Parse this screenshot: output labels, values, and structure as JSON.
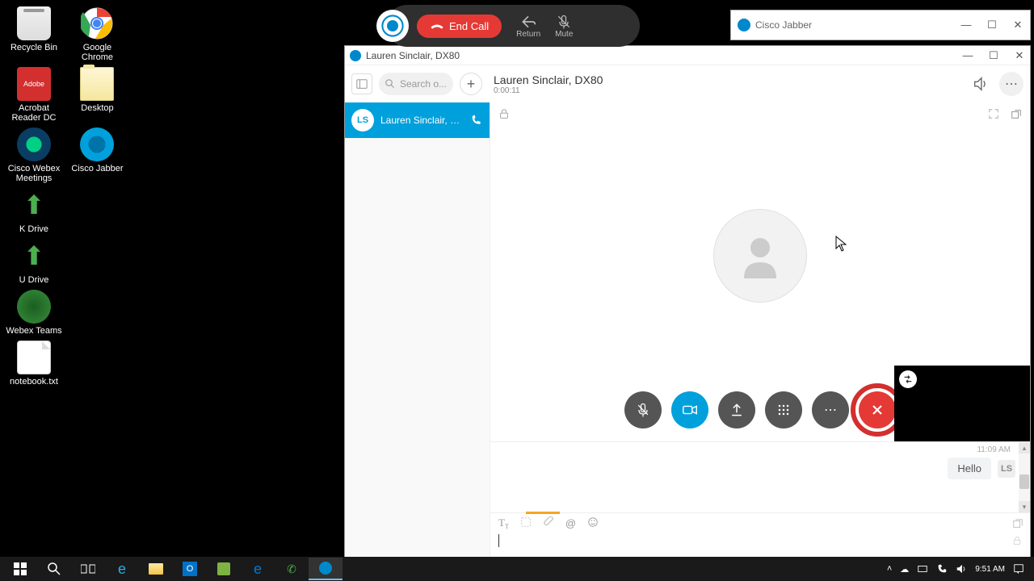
{
  "desktop": {
    "icons": [
      {
        "label": "Recycle Bin"
      },
      {
        "label": "Google Chrome"
      },
      {
        "label": "Acrobat Reader DC"
      },
      {
        "label": "Desktop"
      },
      {
        "label": "Cisco Webex Meetings"
      },
      {
        "label": "Cisco Jabber"
      },
      {
        "label": "K Drive"
      },
      {
        "label": "U Drive"
      },
      {
        "label": "Webex Teams"
      },
      {
        "label": "notebook.txt"
      }
    ]
  },
  "bg_window": {
    "title": "Cisco Jabber"
  },
  "pill": {
    "end_call": "End Call",
    "return": "Return",
    "mute": "Mute"
  },
  "jabber": {
    "title": "Lauren Sinclair, DX80",
    "search_placeholder": "Search o...",
    "contact_name": "Lauren Sinclair, DX80",
    "timer": "0:00:11",
    "conversation": {
      "initials": "LS",
      "name": "Lauren Sinclair, DX..."
    },
    "chat": {
      "time": "11:09 AM",
      "msg": "Hello",
      "initials": "LS"
    }
  },
  "taskbar": {
    "time": "9:51 AM"
  },
  "adobe_label": "Adobe"
}
